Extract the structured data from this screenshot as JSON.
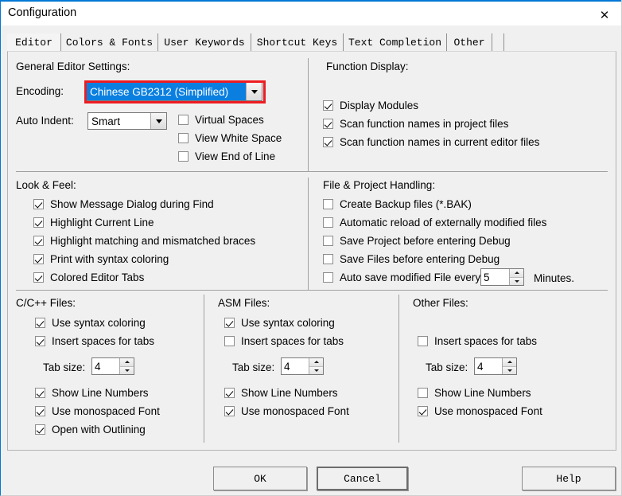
{
  "window": {
    "title": "Configuration",
    "close_icon": "close-icon"
  },
  "tabs": [
    {
      "label": "Editor",
      "active": true
    },
    {
      "label": "Colors & Fonts",
      "active": false
    },
    {
      "label": "User Keywords",
      "active": false
    },
    {
      "label": "Shortcut Keys",
      "active": false
    },
    {
      "label": "Text Completion",
      "active": false
    },
    {
      "label": "Other",
      "active": false
    }
  ],
  "general_editor": {
    "title": "General Editor Settings:",
    "encoding_label": "Encoding:",
    "encoding_value": "Chinese GB2312 (Simplified)",
    "auto_indent_label": "Auto Indent:",
    "auto_indent_value": "Smart",
    "checkboxes": [
      {
        "label": "Virtual Spaces",
        "checked": false
      },
      {
        "label": "View White Space",
        "checked": false
      },
      {
        "label": "View End of Line",
        "checked": false
      }
    ]
  },
  "function_display": {
    "title": "Function Display:",
    "checkboxes": [
      {
        "label": "Display Modules",
        "checked": true
      },
      {
        "label": "Scan function names in project files",
        "checked": true
      },
      {
        "label": "Scan function names in current editor files",
        "checked": true
      }
    ]
  },
  "look_feel": {
    "title": "Look & Feel:",
    "checkboxes": [
      {
        "label": "Show Message Dialog during Find",
        "checked": true
      },
      {
        "label": "Highlight Current Line",
        "checked": true
      },
      {
        "label": "Highlight matching and mismatched braces",
        "checked": true
      },
      {
        "label": "Print with syntax coloring",
        "checked": true
      },
      {
        "label": "Colored Editor Tabs",
        "checked": true
      }
    ]
  },
  "file_project": {
    "title": "File & Project Handling:",
    "checkboxes": [
      {
        "label": "Create Backup files (*.BAK)",
        "checked": false
      },
      {
        "label": "Automatic reload of externally modified files",
        "checked": false
      },
      {
        "label": "Save Project before entering Debug",
        "checked": false
      },
      {
        "label": "Save Files before entering Debug",
        "checked": false
      },
      {
        "label": "Auto save modified File every",
        "checked": false
      }
    ],
    "autosave_value": "5",
    "autosave_suffix": "Minutes."
  },
  "cpp_files": {
    "title": "C/C++ Files:",
    "syntax_coloring": {
      "label": "Use syntax coloring",
      "checked": true
    },
    "insert_spaces": {
      "label": "Insert spaces for tabs",
      "checked": true
    },
    "tab_size_label": "Tab size:",
    "tab_size_value": "4",
    "line_numbers": {
      "label": "Show Line Numbers",
      "checked": true
    },
    "monospaced": {
      "label": "Use monospaced Font",
      "checked": true
    },
    "outlining": {
      "label": "Open with Outlining",
      "checked": true
    }
  },
  "asm_files": {
    "title": "ASM Files:",
    "syntax_coloring": {
      "label": "Use syntax coloring",
      "checked": true
    },
    "insert_spaces": {
      "label": "Insert spaces for tabs",
      "checked": false
    },
    "tab_size_label": "Tab size:",
    "tab_size_value": "4",
    "line_numbers": {
      "label": "Show Line Numbers",
      "checked": true
    },
    "monospaced": {
      "label": "Use monospaced Font",
      "checked": true
    }
  },
  "other_files": {
    "title": "Other Files:",
    "insert_spaces": {
      "label": "Insert spaces for tabs",
      "checked": false
    },
    "tab_size_label": "Tab size:",
    "tab_size_value": "4",
    "line_numbers": {
      "label": "Show Line Numbers",
      "checked": false
    },
    "monospaced": {
      "label": "Use monospaced Font",
      "checked": true
    }
  },
  "buttons": {
    "ok": "OK",
    "cancel": "Cancel",
    "help": "Help"
  },
  "annotation": {
    "color": "#ee1c22",
    "target": "encoding-combo"
  }
}
